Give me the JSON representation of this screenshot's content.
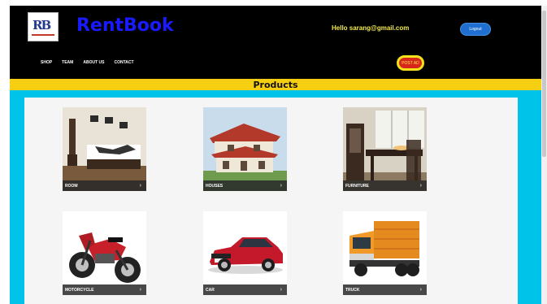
{
  "header": {
    "logo_text": "RB",
    "brand": "RentBook",
    "greeting": "Hello sarang@gmail.com",
    "logout_label": "Logout",
    "post_ad_label": "POST AD",
    "nav": [
      {
        "label": "SHOP"
      },
      {
        "label": "TEAM"
      },
      {
        "label": "ABOUT US"
      },
      {
        "label": "CONTACT"
      }
    ]
  },
  "section_title": "Products",
  "products": [
    {
      "label": "ROOM",
      "arrow": "›"
    },
    {
      "label": "HOUSES",
      "arrow": "›"
    },
    {
      "label": "FURNITURE",
      "arrow": "›"
    },
    {
      "label": "MOTORCYCLE",
      "arrow": "›"
    },
    {
      "label": "CAR",
      "arrow": "›"
    },
    {
      "label": "TRUCK",
      "arrow": "›"
    }
  ],
  "colors": {
    "header_bg": "#000000",
    "brand": "#1a1aff",
    "greeting": "#f2e94b",
    "title_bar": "#f7cf12",
    "content_bg": "#00c3ea",
    "logout": "#1f6fd1",
    "post_ad": "#d9261c"
  }
}
